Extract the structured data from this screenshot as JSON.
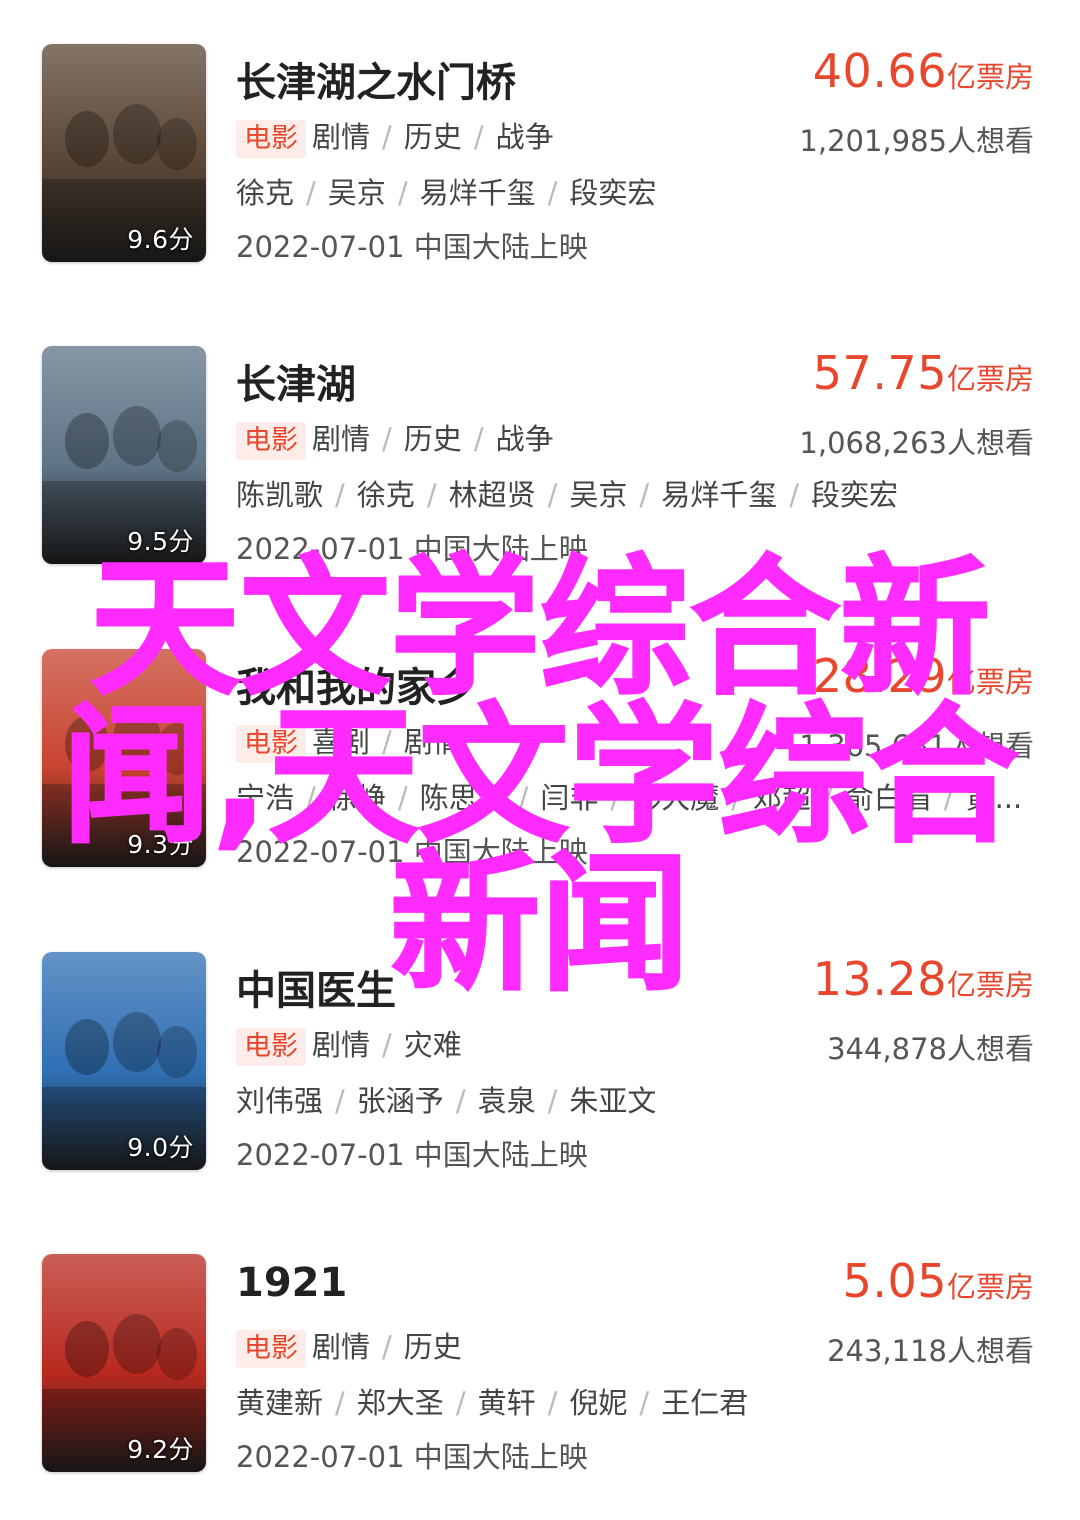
{
  "movies": [
    {
      "title": "长津湖之水门桥",
      "score": "9.6分",
      "gross_value": "40.66",
      "gross_unit": "亿票房",
      "category": "电影",
      "genres": [
        "剧情",
        "历史",
        "战争"
      ],
      "want": "1,201,985人想看",
      "cast": [
        "徐克",
        "吴京",
        "易烊千玺",
        "段奕宏"
      ],
      "release": "2022-07-01 中国大陆上映",
      "poster_color": "#5a4636"
    },
    {
      "title": "长津湖",
      "score": "9.5分",
      "gross_value": "57.75",
      "gross_unit": "亿票房",
      "category": "电影",
      "genres": [
        "剧情",
        "历史",
        "战争"
      ],
      "want": "1,068,263人想看",
      "cast": [
        "陈凯歌",
        "徐克",
        "林超贤",
        "吴京",
        "易烊千玺",
        "段奕宏"
      ],
      "release": "2022-07-01 中国大陆上映",
      "poster_color": "#5f7487"
    },
    {
      "title": "我和我的家乡",
      "score": "9.3分",
      "gross_value": "28.29",
      "gross_unit": "亿票房",
      "category": "电影",
      "genres": [
        "喜剧",
        "剧情"
      ],
      "want": "1,365,681人想看",
      "cast": [
        "宁浩",
        "徐峥",
        "陈思诚",
        "闫非",
        "彭大魔",
        "邓超",
        "俞白眉",
        "黄..."
      ],
      "release": "2022-07-01 中国大陆上映",
      "poster_color": "#c7432f"
    },
    {
      "title": "中国医生",
      "score": "9.0分",
      "gross_value": "13.28",
      "gross_unit": "亿票房",
      "category": "电影",
      "genres": [
        "剧情",
        "灾难"
      ],
      "want": "344,878人想看",
      "cast": [
        "刘伟强",
        "张涵予",
        "袁泉",
        "朱亚文"
      ],
      "release": "2022-07-01 中国大陆上映",
      "poster_color": "#2f6fb3"
    },
    {
      "title": "1921",
      "score": "9.2分",
      "gross_value": "5.05",
      "gross_unit": "亿票房",
      "category": "电影",
      "genres": [
        "剧情",
        "历史"
      ],
      "want": "243,118人想看",
      "cast": [
        "黄建新",
        "郑大圣",
        "黄轩",
        "倪妮",
        "王仁君"
      ],
      "release": "2022-07-01 中国大陆上映",
      "poster_color": "#b8291f"
    }
  ],
  "overlay_text": "天文学综合新闻,天文学综合新闻",
  "colors": {
    "accent": "#e8472e",
    "tag_bg": "#fdece7",
    "overlay": "#ff2bff"
  }
}
